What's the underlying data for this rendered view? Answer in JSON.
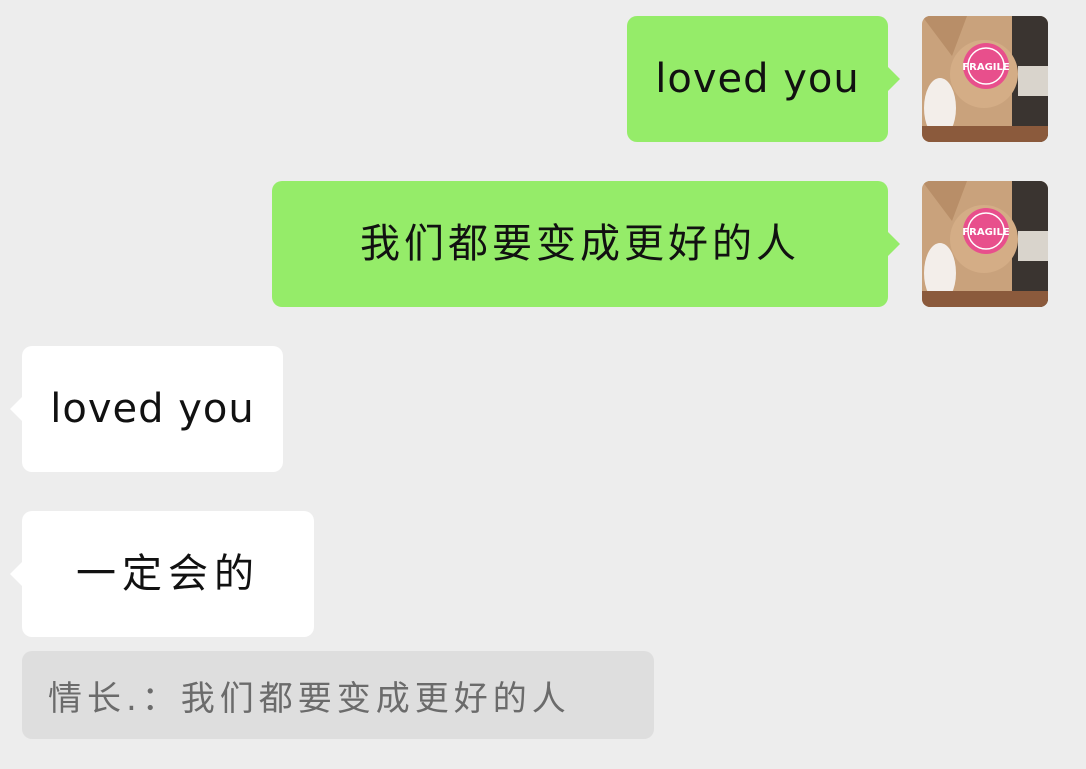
{
  "messages": [
    {
      "side": "outgoing",
      "text": "loved you"
    },
    {
      "side": "outgoing",
      "text": "我们都要变成更好的人"
    },
    {
      "side": "incoming",
      "text": "loved you"
    },
    {
      "side": "incoming",
      "text": "一定会的"
    }
  ],
  "quote": {
    "text": "情长.：我们都要变成更好的人"
  },
  "avatar": {
    "icon": "cat-avatar-icon",
    "sticker_text": "FRAGILE",
    "sticker_color": "#e84f8c"
  },
  "colors": {
    "background": "#ededed",
    "outgoing_bubble": "#95ec69",
    "incoming_bubble": "#ffffff",
    "quote_background": "#dedede"
  }
}
